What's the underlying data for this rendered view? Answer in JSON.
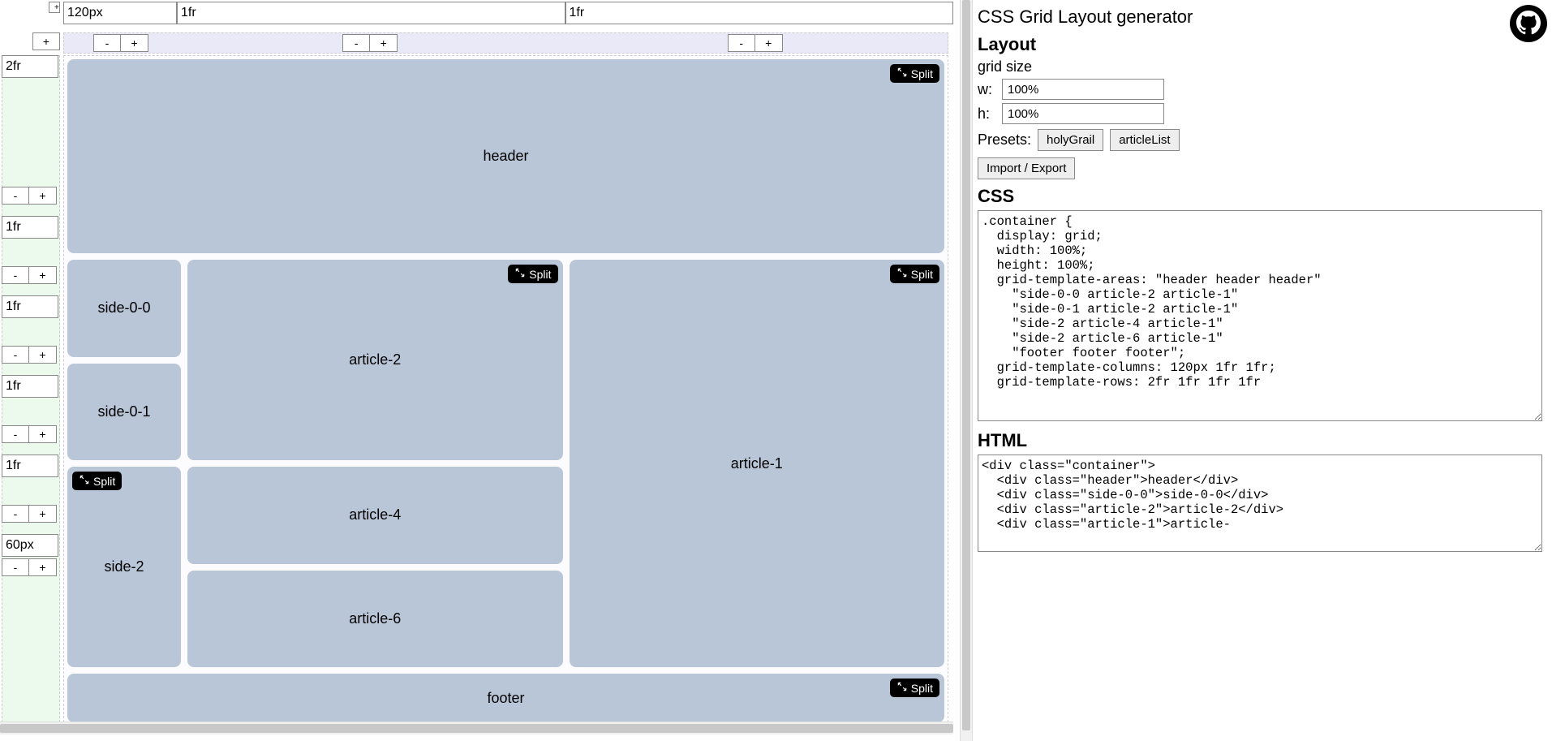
{
  "page_title": "CSS Grid Layout generator",
  "layout_section": {
    "heading": "Layout",
    "grid_size_label": "grid size",
    "w_label": "w:",
    "w_value": "100%",
    "h_label": "h:",
    "h_value": "100%",
    "presets_label": "Presets:",
    "preset_holygrail": "holyGrail",
    "preset_articlelist": "articleList",
    "import_export": "Import / Export"
  },
  "css_section": {
    "heading": "CSS",
    "code": ".container {\n  display: grid;\n  width: 100%;\n  height: 100%;\n  grid-template-areas: \"header header header\"\n    \"side-0-0 article-2 article-1\"\n    \"side-0-1 article-2 article-1\"\n    \"side-2 article-4 article-1\"\n    \"side-2 article-6 article-1\"\n    \"footer footer footer\";\n  grid-template-columns: 120px 1fr 1fr;\n  grid-template-rows: 2fr 1fr 1fr 1fr"
  },
  "html_section": {
    "heading": "HTML",
    "code": "<div class=\"container\">\n  <div class=\"header\">header</div>\n  <div class=\"side-0-0\">side-0-0</div>\n  <div class=\"article-2\">article-2</div>\n  <div class=\"article-1\">article-"
  },
  "columns": [
    {
      "size": "120px"
    },
    {
      "size": "1fr"
    },
    {
      "size": "1fr"
    }
  ],
  "rows": [
    {
      "size": "2fr"
    },
    {
      "size": "1fr"
    },
    {
      "size": "1fr"
    },
    {
      "size": "1fr"
    },
    {
      "size": "1fr"
    },
    {
      "size": "60px"
    }
  ],
  "buttons": {
    "minus": "-",
    "plus": "+",
    "split": "Split",
    "add": "+"
  },
  "areas": {
    "header": "header",
    "side00": "side-0-0",
    "side01": "side-0-1",
    "side2": "side-2",
    "article2": "article-2",
    "article4": "article-4",
    "article6": "article-6",
    "article1": "article-1",
    "footer": "footer"
  },
  "split_visible_on": [
    "header",
    "side2",
    "article2",
    "article1",
    "footer"
  ]
}
